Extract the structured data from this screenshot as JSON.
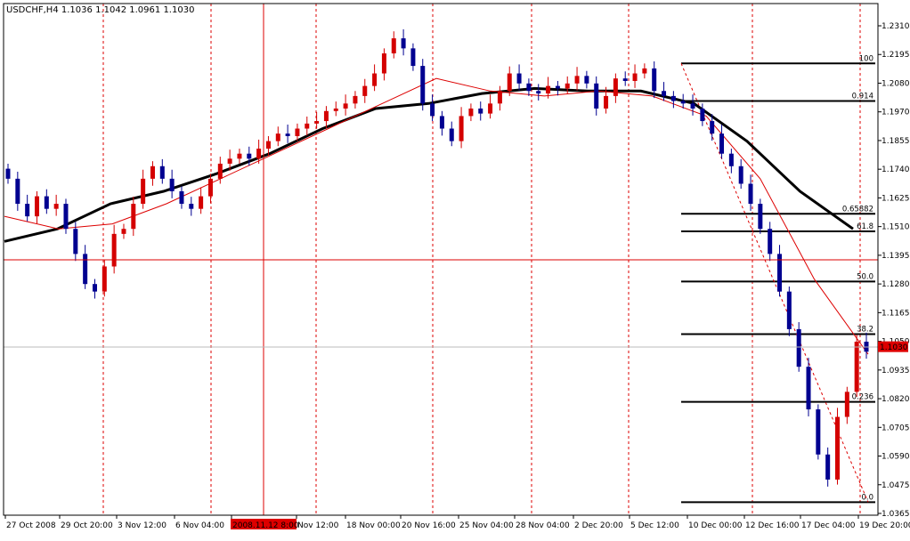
{
  "header": {
    "symbol": "USDCHF,H4",
    "open": "1.1036",
    "high": "1.1042",
    "low": "1.0961",
    "close": "1.1030"
  },
  "colors": {
    "bull": "#d40000",
    "bear": "#000090",
    "ma_slow": "#000000",
    "ma_fast": "#dd0000",
    "vgrid": "#dd0000",
    "crosshair": "#dd0000",
    "fib": "#000000",
    "price_marker": "#dd0000"
  },
  "price_axis": {
    "labels": [
      "1.2310",
      "1.2195",
      "1.2080",
      "1.1970",
      "1.1855",
      "1.1740",
      "1.1625",
      "1.1510",
      "1.1395",
      "1.1280",
      "1.1165",
      "1.1050",
      "1.0935",
      "1.0820",
      "1.0705",
      "1.0590",
      "1.0475",
      "1.0365"
    ],
    "current": "1.1030"
  },
  "time_axis": {
    "labels": [
      "27 Oct 2008",
      "29 Oct 20:00",
      "3 Nov 12:00",
      "6 Nov 04:00",
      "2008.11.12 8:00",
      "Nov 12:00",
      "18 Nov 00:00",
      "20 Nov 16:00",
      "25 Nov 04:00",
      "28 Nov 04:00",
      "2 Dec 20:00",
      "5 Dec 12:00",
      "10 Dec 00:00",
      "12 Dec 16:00",
      "17 Dec 04:00",
      "19 Dec 20:00"
    ],
    "highlighted": "2008.11.12 8:00"
  },
  "fibonacci": [
    {
      "label": "100",
      "price": 1.216
    },
    {
      "label": "0.914",
      "price": 1.201
    },
    {
      "label": "0.65882",
      "price": 1.156
    },
    {
      "label": "61.8",
      "price": 1.149
    },
    {
      "label": "50.0",
      "price": 1.129
    },
    {
      "label": "38.2",
      "price": 1.108
    },
    {
      "label": "0.236",
      "price": 1.081
    },
    {
      "label": "0.0",
      "price": 1.041
    }
  ],
  "chart_data": {
    "type": "candlestick",
    "title": "USDCHF,H4",
    "ylim": [
      1.0365,
      1.231
    ],
    "grid": "vertical dashed red lines at time labels",
    "series": [
      {
        "name": "close",
        "values": [
          1.17,
          1.16,
          1.155,
          1.163,
          1.158,
          1.16,
          1.15,
          1.14,
          1.128,
          1.125,
          1.135,
          1.148,
          1.15,
          1.16,
          1.17,
          1.175,
          1.17,
          1.165,
          1.16,
          1.158,
          1.163,
          1.17,
          1.176,
          1.178,
          1.18,
          1.178,
          1.182,
          1.185,
          1.188,
          1.187,
          1.19,
          1.192,
          1.193,
          1.197,
          1.198,
          1.2,
          1.203,
          1.207,
          1.212,
          1.22,
          1.226,
          1.222,
          1.215,
          1.2,
          1.195,
          1.19,
          1.185,
          1.195,
          1.198,
          1.196,
          1.2,
          1.205,
          1.212,
          1.208,
          1.205,
          1.204,
          1.207,
          1.206,
          1.208,
          1.211,
          1.208,
          1.198,
          1.203,
          1.21,
          1.209,
          1.212,
          1.214,
          1.205,
          1.203,
          1.201,
          1.2,
          1.198,
          1.193,
          1.188,
          1.18,
          1.175,
          1.168,
          1.16,
          1.15,
          1.14,
          1.125,
          1.11,
          1.095,
          1.078,
          1.06,
          1.05,
          1.075,
          1.085,
          1.105,
          1.101
        ]
      },
      {
        "name": "slow moving average",
        "values": [
          1.145,
          1.15,
          1.16,
          1.165,
          1.172,
          1.18,
          1.19,
          1.198,
          1.2,
          1.204,
          1.206,
          1.205,
          1.205,
          1.2,
          1.185,
          1.165,
          1.15
        ]
      },
      {
        "name": "fast moving average",
        "values": [
          1.155,
          1.15,
          1.152,
          1.16,
          1.17,
          1.18,
          1.19,
          1.2,
          1.21,
          1.205,
          1.203,
          1.205,
          1.203,
          1.195,
          1.17,
          1.13,
          1.1
        ]
      }
    ]
  }
}
